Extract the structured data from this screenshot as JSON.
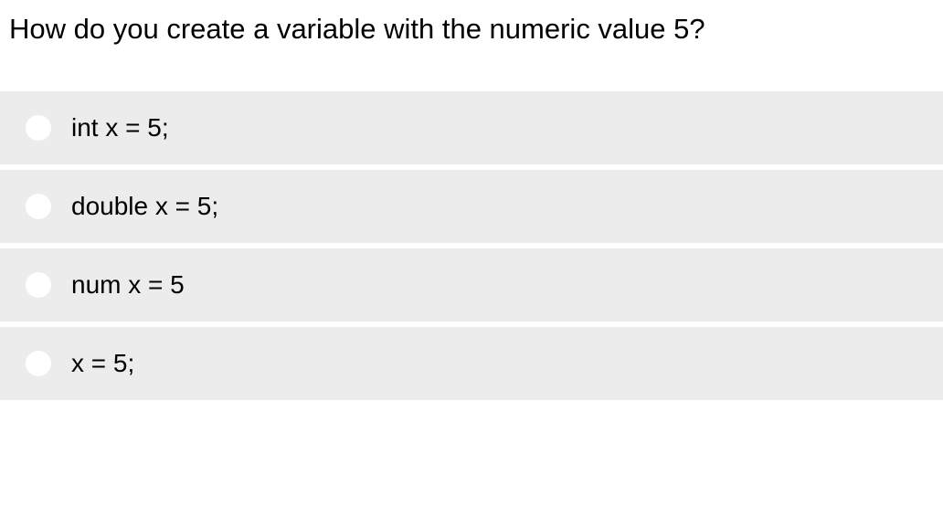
{
  "question": {
    "text": "How do you create a variable with the numeric value 5?"
  },
  "options": [
    {
      "label": "int x = 5;"
    },
    {
      "label": "double x = 5;"
    },
    {
      "label": "num x = 5"
    },
    {
      "label": "x = 5;"
    }
  ]
}
